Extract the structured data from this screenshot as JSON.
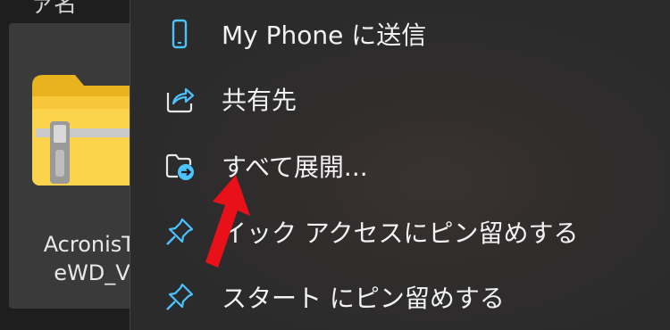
{
  "explorer": {
    "top_fragment": "ァ名",
    "file_name": "AcronisTr\neWD_V"
  },
  "context_menu": {
    "items": [
      {
        "label": "My Phone に送信",
        "icon": "phone-icon"
      },
      {
        "label": "共有先",
        "icon": "share-icon"
      },
      {
        "label": "すべて展開...",
        "icon": "extract-folder-icon"
      },
      {
        "label": "イック アクセスにピン留めする",
        "icon": "pin-icon"
      },
      {
        "label": "スタート にピン留めする",
        "icon": "pin-icon"
      }
    ]
  },
  "colors": {
    "icon_blue": "#4cc2ff",
    "arrow_red": "#e8111a"
  }
}
